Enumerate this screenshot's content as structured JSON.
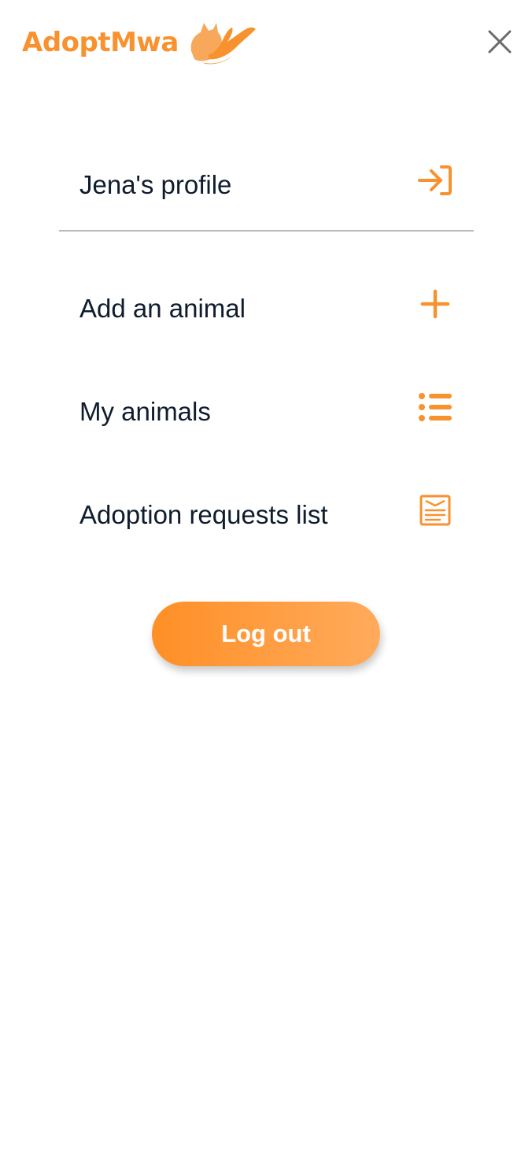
{
  "brand": {
    "name": "AdoptMwa",
    "logo_icon": "cat-in-hand-icon",
    "color": "#f7922e"
  },
  "header": {
    "close_icon": "close-icon"
  },
  "menu": {
    "items": [
      {
        "label": "Jena's profile",
        "icon": "sign-in-arrow-icon"
      },
      {
        "label": "Add an animal",
        "icon": "plus-icon"
      },
      {
        "label": "My animals",
        "icon": "list-icon"
      },
      {
        "label": "Adoption requests list",
        "icon": "requests-list-icon"
      }
    ]
  },
  "logout": {
    "label": "Log out"
  },
  "colors": {
    "accent": "#f7922e",
    "text": "#0f1c2e",
    "divider": "#b8b8b8",
    "close_icon": "#6b6b6b"
  }
}
